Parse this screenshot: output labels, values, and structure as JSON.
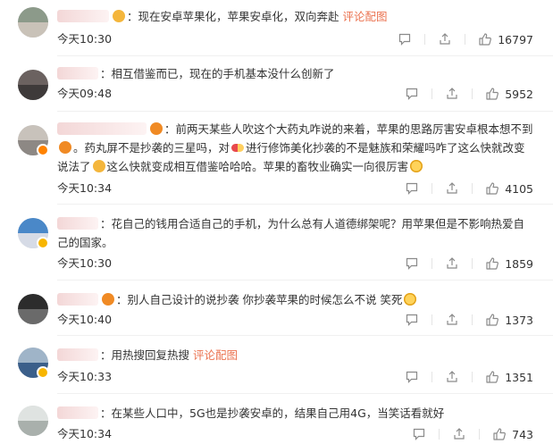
{
  "icons": {
    "comment": "comment-icon",
    "share": "share-icon",
    "like": "thumbs-up-icon"
  },
  "comments": [
    {
      "text": "：现在安卓苹果化，苹果安卓化，双向奔赴",
      "link": "评论配图",
      "time": "今天10:30",
      "likes": "16797"
    },
    {
      "text": "：相互借鉴而已，现在的手机基本没什么创新了",
      "time": "今天09:48",
      "likes": "5952"
    },
    {
      "text_a": "：前两天某些人吹这个大药丸咋说的来着，苹果的思路厉害安卓根本想不到",
      "text_b": "。药丸屏不是抄袭的三星吗，对",
      "text_c": "进行修饰美化抄袭的不是魅族和荣耀吗咋了这么快就改变说法了",
      "text_d": "这么快就变成相互借鉴哈哈哈。苹果的畜牧业确实一向很厉害",
      "time": "今天10:34",
      "likes": "4105"
    },
    {
      "text": "：花自己的钱用合适自己的手机，为什么总有人道德绑架呢？用苹果但是不影响热爱自己的国家。",
      "time": "今天10:30",
      "likes": "1859"
    },
    {
      "text": "：别人自己设计的说抄袭 你抄袭苹果的时候怎么不说 笑死",
      "time": "今天10:40",
      "likes": "1373"
    },
    {
      "text": "：用热搜回复热搜",
      "link": "评论配图",
      "time": "今天10:33",
      "likes": "1351"
    },
    {
      "text": "：在某些人口中，5G也是抄袭安卓的，结果自己用4G，当笑话看就好",
      "time": "今天10:34",
      "likes": "743"
    }
  ]
}
